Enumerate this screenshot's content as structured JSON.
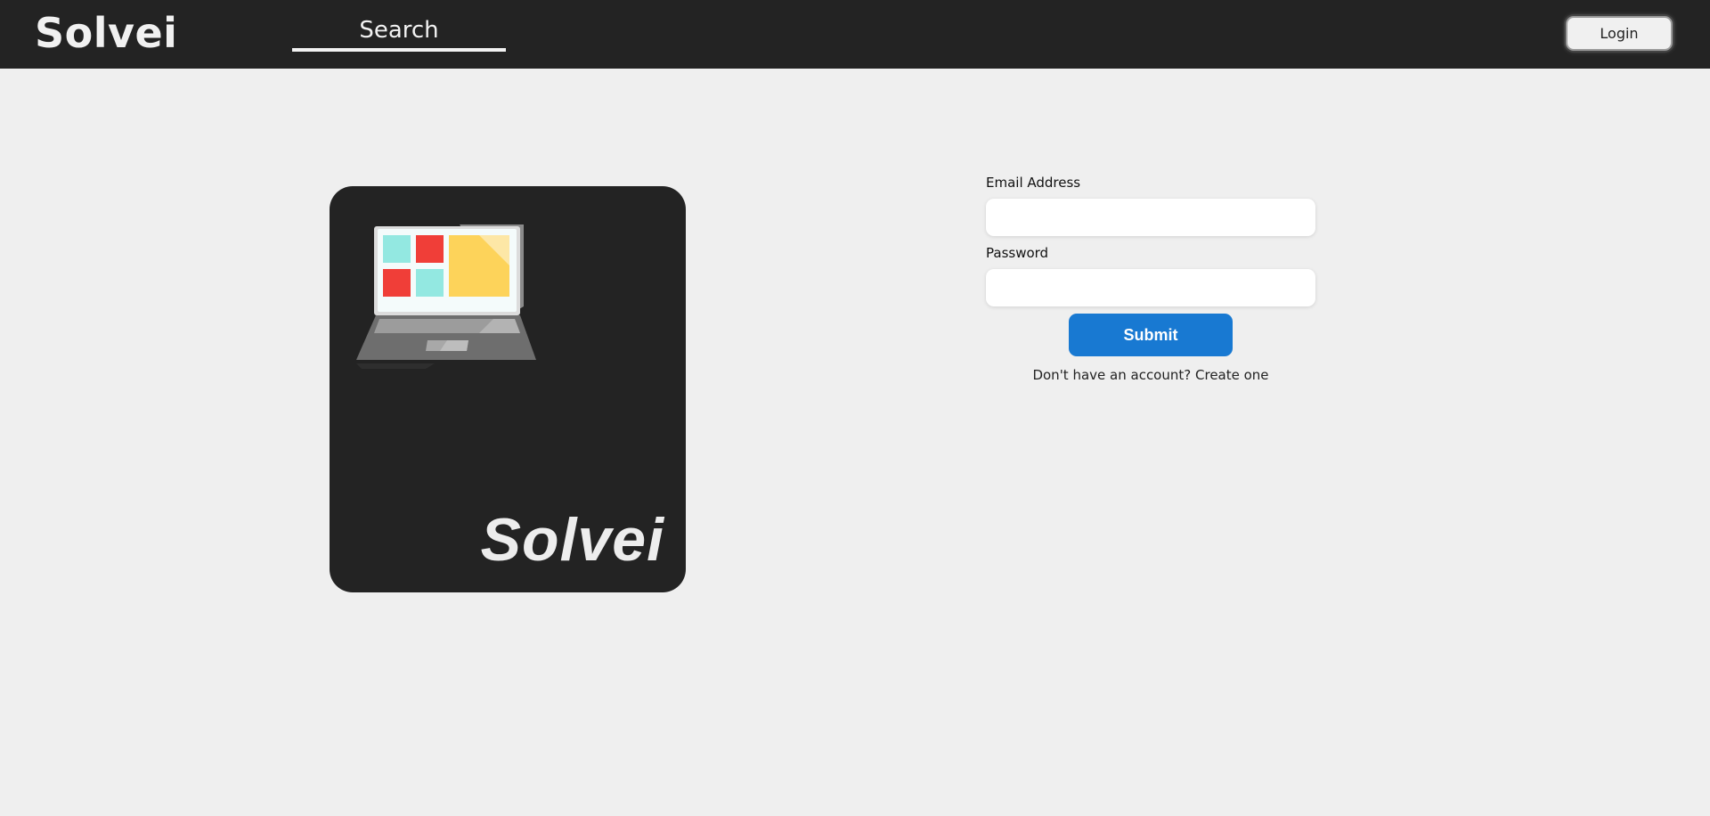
{
  "header": {
    "brand": "Solvei",
    "search_placeholder": "Search",
    "login_label": "Login"
  },
  "hero": {
    "illustration_icon": "laptop-dashboard-icon",
    "wordmark": "Solvei"
  },
  "form": {
    "email_label": "Email Address",
    "email_value": "",
    "password_label": "Password",
    "password_value": "",
    "submit_label": "Submit",
    "signup_prompt": "Don't have an account?",
    "signup_link": "Create one"
  },
  "colors": {
    "header_bg": "#232323",
    "page_bg": "#efefef",
    "primary": "#1879d2",
    "tile_teal": "#93e8e1",
    "tile_red": "#f03e38",
    "tile_yellow": "#fdd35a"
  }
}
